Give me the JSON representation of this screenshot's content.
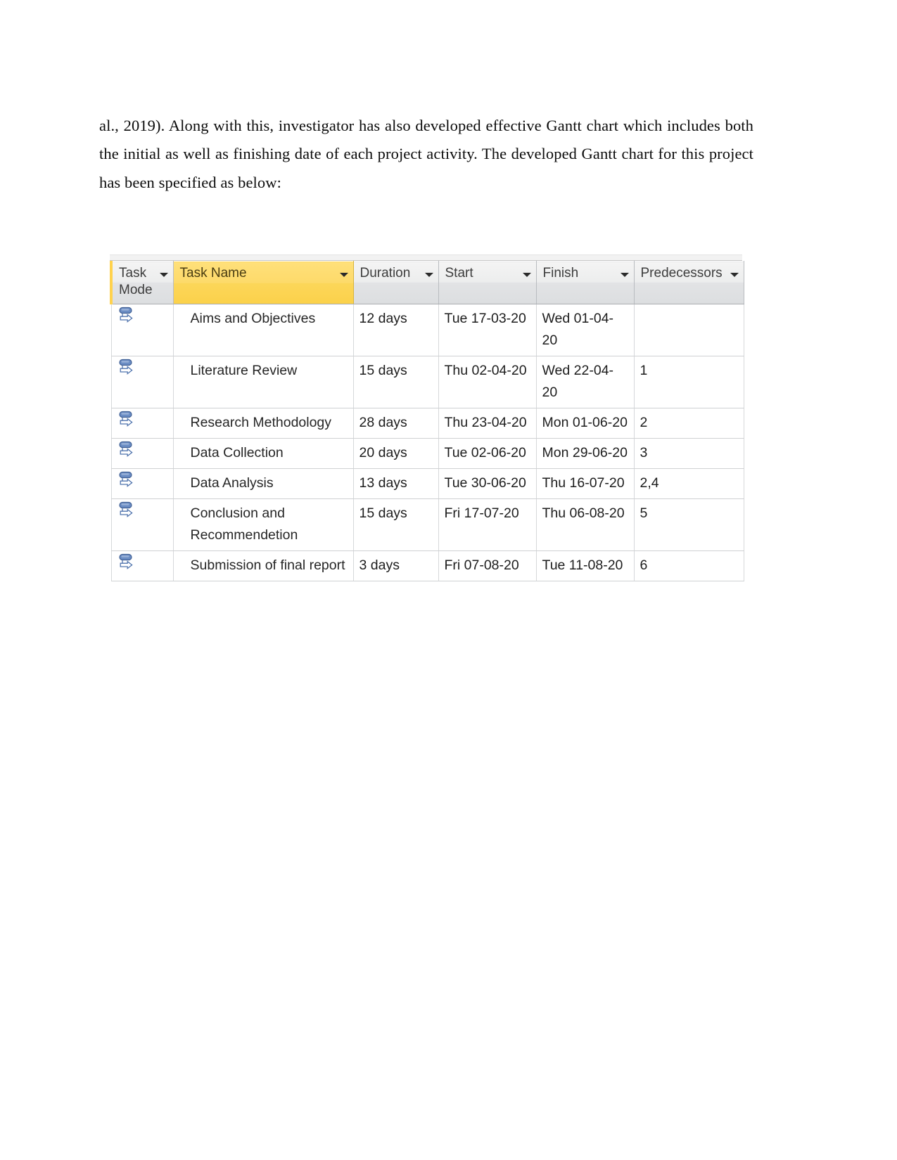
{
  "document": {
    "paragraph": "al., 2019). Along with this, investigator has also developed effective Gantt chart which includes both the initial as well as finishing date of each project activity. The developed Gantt chart for this project has been specified as below:"
  },
  "grid": {
    "headers": [
      {
        "label": "Task Mode",
        "name": "task-mode"
      },
      {
        "label": "Task Name",
        "name": "task-name"
      },
      {
        "label": "Duration",
        "name": "duration"
      },
      {
        "label": "Start",
        "name": "start"
      },
      {
        "label": "Finish",
        "name": "finish"
      },
      {
        "label": "Predecessors",
        "name": "predecessors"
      }
    ],
    "highlight_color": "#fbd14a",
    "task_mode_icon": "manually-scheduled-icon",
    "rows": [
      {
        "task_mode": "manually-scheduled-icon",
        "task_name": "Aims and Objectives",
        "duration": "12 days",
        "start": "Tue 17-03-20",
        "finish": "Wed 01-04-20",
        "predecessors": ""
      },
      {
        "task_mode": "manually-scheduled-icon",
        "task_name": "Literature Review",
        "duration": "15 days",
        "start": "Thu 02-04-20",
        "finish": "Wed 22-04-20",
        "predecessors": "1"
      },
      {
        "task_mode": "manually-scheduled-icon",
        "task_name": "Research Methodology",
        "duration": "28 days",
        "start": "Thu 23-04-20",
        "finish": "Mon 01-06-20",
        "predecessors": "2"
      },
      {
        "task_mode": "manually-scheduled-icon",
        "task_name": "Data Collection",
        "duration": "20 days",
        "start": "Tue 02-06-20",
        "finish": "Mon 29-06-20",
        "predecessors": "3"
      },
      {
        "task_mode": "manually-scheduled-icon",
        "task_name": "Data Analysis",
        "duration": "13 days",
        "start": "Tue 30-06-20",
        "finish": "Thu 16-07-20",
        "predecessors": "2,4"
      },
      {
        "task_mode": "manually-scheduled-icon",
        "task_name": "Conclusion and Recommendetion",
        "duration": "15 days",
        "start": "Fri 17-07-20",
        "finish": "Thu 06-08-20",
        "predecessors": "5"
      },
      {
        "task_mode": "manually-scheduled-icon",
        "task_name": "Submission of final report",
        "duration": "3 days",
        "start": "Fri 07-08-20",
        "finish": "Tue 11-08-20",
        "predecessors": "6"
      }
    ]
  }
}
